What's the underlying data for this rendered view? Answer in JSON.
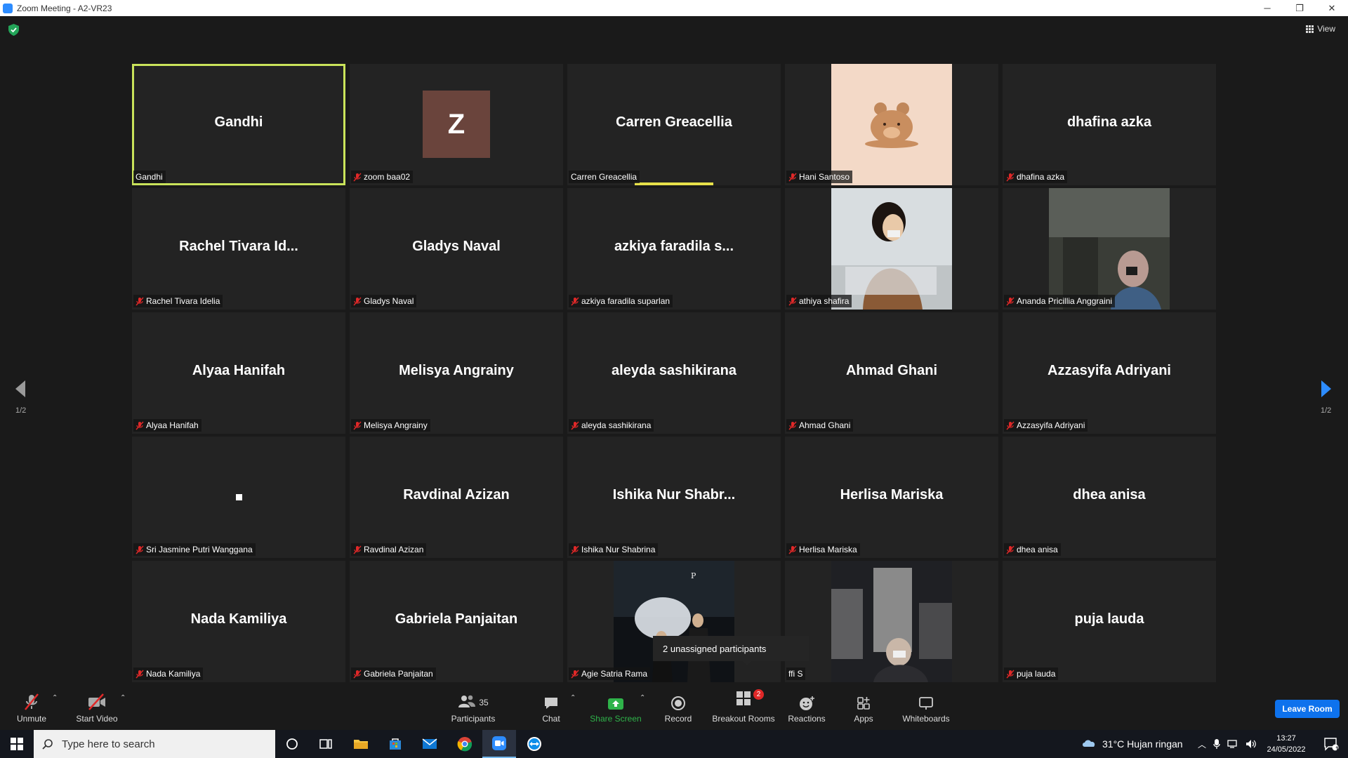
{
  "window": {
    "title": "Zoom Meeting - A2-VR23",
    "minimize": "─",
    "restore": "❐",
    "close": "✕"
  },
  "view_label": "View",
  "pager": {
    "left": "1/2",
    "right": "1/2"
  },
  "tiles": [
    {
      "display": "Gandhi",
      "label": "Gandhi",
      "muted": false,
      "active": true,
      "kind": "name"
    },
    {
      "display": "Z",
      "label": "zoom baa02",
      "muted": true,
      "kind": "avatar"
    },
    {
      "display": "Carren Greacellia",
      "label": "Carren Greacellia",
      "muted": false,
      "speaking": true,
      "kind": "name"
    },
    {
      "display": "",
      "label": "Hani Santoso",
      "muted": true,
      "kind": "bear"
    },
    {
      "display": "dhafina azka",
      "label": "dhafina azka",
      "muted": true,
      "kind": "name"
    },
    {
      "display": "Rachel Tivara Id...",
      "label": "Rachel Tivara Idelia",
      "muted": true,
      "kind": "name"
    },
    {
      "display": "Gladys Naval",
      "label": "Gladys Naval",
      "muted": true,
      "kind": "name"
    },
    {
      "display": "azkiya faradila s...",
      "label": "azkiya faradila suparlan",
      "muted": true,
      "kind": "name"
    },
    {
      "display": "",
      "label": "athiya shafira",
      "muted": true,
      "kind": "photo1"
    },
    {
      "display": "",
      "label": "Ananda Pricillia Anggraini",
      "muted": true,
      "kind": "photo2"
    },
    {
      "display": "Alyaa Hanifah",
      "label": "Alyaa Hanifah",
      "muted": true,
      "kind": "name"
    },
    {
      "display": "Melisya Angrainy",
      "label": "Melisya Angrainy",
      "muted": true,
      "kind": "name"
    },
    {
      "display": "aleyda sashikirana",
      "label": "aleyda sashikirana",
      "muted": true,
      "kind": "name"
    },
    {
      "display": "Ahmad Ghani",
      "label": "Ahmad Ghani",
      "muted": true,
      "kind": "name"
    },
    {
      "display": "Azzasyifa Adriyani",
      "label": "Azzasyifa Adriyani",
      "muted": true,
      "kind": "name"
    },
    {
      "display": "",
      "label": "Sri Jasmine Putri Wanggana",
      "muted": true,
      "kind": "dot"
    },
    {
      "display": "Ravdinal Azizan",
      "label": "Ravdinal Azizan",
      "muted": true,
      "kind": "name"
    },
    {
      "display": "Ishika Nur Shabr...",
      "label": "Ishika Nur Shabrina",
      "muted": true,
      "kind": "name"
    },
    {
      "display": "Herlisa Mariska",
      "label": "Herlisa Mariska",
      "muted": true,
      "kind": "name"
    },
    {
      "display": "dhea anisa",
      "label": "dhea anisa",
      "muted": true,
      "kind": "name"
    },
    {
      "display": "Nada Kamiliya",
      "label": "Nada Kamiliya",
      "muted": true,
      "kind": "name"
    },
    {
      "display": "Gabriela Panjaitan",
      "label": "Gabriela Panjaitan",
      "muted": true,
      "kind": "name"
    },
    {
      "display": "",
      "label": "Agie Satria Rama",
      "muted": true,
      "kind": "photo3"
    },
    {
      "display": "",
      "label": "ffi S",
      "muted": false,
      "kind": "photo4"
    },
    {
      "display": "puja lauda",
      "label": "puja lauda",
      "muted": true,
      "kind": "name"
    }
  ],
  "tooltip": "2 unassigned participants",
  "toolbar": {
    "unmute": "Unmute",
    "start_video": "Start Video",
    "participants": "Participants",
    "participants_count": "35",
    "chat": "Chat",
    "share_screen": "Share Screen",
    "record": "Record",
    "breakout_rooms": "Breakout Rooms",
    "breakout_badge": "2",
    "reactions": "Reactions",
    "apps": "Apps",
    "whiteboards": "Whiteboards",
    "leave": "Leave Room"
  },
  "taskbar": {
    "search_placeholder": "Type here to search",
    "weather": "31°C  Hujan ringan",
    "time": "13:27",
    "date": "24/05/2022",
    "notification_count": "1"
  },
  "colors": {
    "accent": "#0e72ed",
    "active_border": "#c9e35a",
    "share_green": "#2fb34a",
    "muted_red": "#e02828"
  }
}
